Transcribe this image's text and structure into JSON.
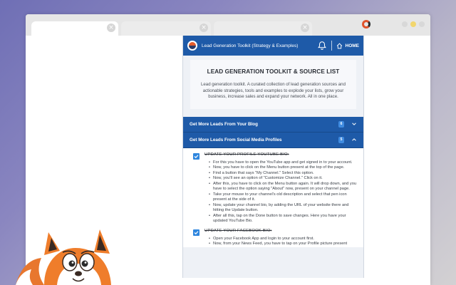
{
  "browser": {
    "tabs": [
      {
        "active": true
      },
      {
        "active": false
      },
      {
        "active": false
      }
    ],
    "close_glyph": "×"
  },
  "popup": {
    "header": {
      "title": "Lead Generation Toolkit (Strategy & Examples)",
      "home_label": "HOME",
      "colors": {
        "header_bg": "#1e5aa8",
        "badge_bg": "#3f8be0"
      }
    },
    "hero": {
      "title": "LEAD GENERATION TOOLKIT & SOURCE LIST",
      "description": "Lead generation toolkit. A curated collection of lead generation sources and actionable strategies, tools and examples to explode your lists, grow your business, increase sales and expand your network. All in one place."
    },
    "sections": [
      {
        "label": "Get More Leads From Your Blog",
        "badge": "6",
        "expanded": false
      },
      {
        "label": "Get More Leads From Social Media Profiles",
        "badge": "5",
        "expanded": true
      }
    ],
    "items": [
      {
        "title": "UPDATE YOUR PROFILE YOUTUBE BIO:",
        "checked": true,
        "steps": [
          "For this you have to open the YouTube app and get signed in to your account.",
          "Now, you have to click on the Menu button present at the top of the page.",
          "Find a button that says \"My Channel.\" Select this option.",
          "Now, you'll see an option of \"Customize Channel.\" Click on it.",
          "After this, you have to click on the Menu button again. It will drop down, and you have to select the option saying \"About\" now, present on your channel page.",
          "Take your mouse to your channel's old description and select that pen icon present at the side of it.",
          "Now, update your channel bio, by adding the URL of your website there and hitting the Update button.",
          "After all this, tap on the Done button to save changes. Here you have your updated YouTube Bio."
        ]
      },
      {
        "title": "UPDATE YOUR FACEBOOK BIO:",
        "checked": true,
        "steps": [
          "Open your Facebook App and login to your account first.",
          "Now, from your News Feed, you have to tap on your Profile picture present"
        ]
      }
    ]
  }
}
